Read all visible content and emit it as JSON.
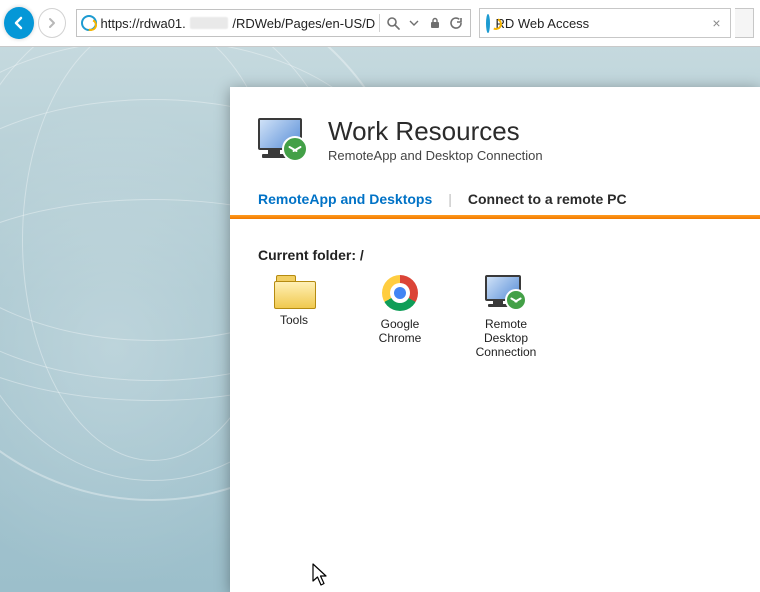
{
  "browser": {
    "url_start": "https://rdwa01.",
    "url_rest": "/RDWeb/Pages/en-US/D",
    "tab_title": "RD Web Access"
  },
  "page": {
    "title": "Work Resources",
    "subtitle": "RemoteApp and Desktop Connection",
    "tab_active": "RemoteApp and Desktops",
    "tab_secondary": "Connect to a remote PC",
    "folder_label": "Current folder: /",
    "apps": [
      {
        "label": "Tools"
      },
      {
        "label": "Google\nChrome"
      },
      {
        "label": "Remote\nDesktop\nConnection"
      }
    ]
  }
}
